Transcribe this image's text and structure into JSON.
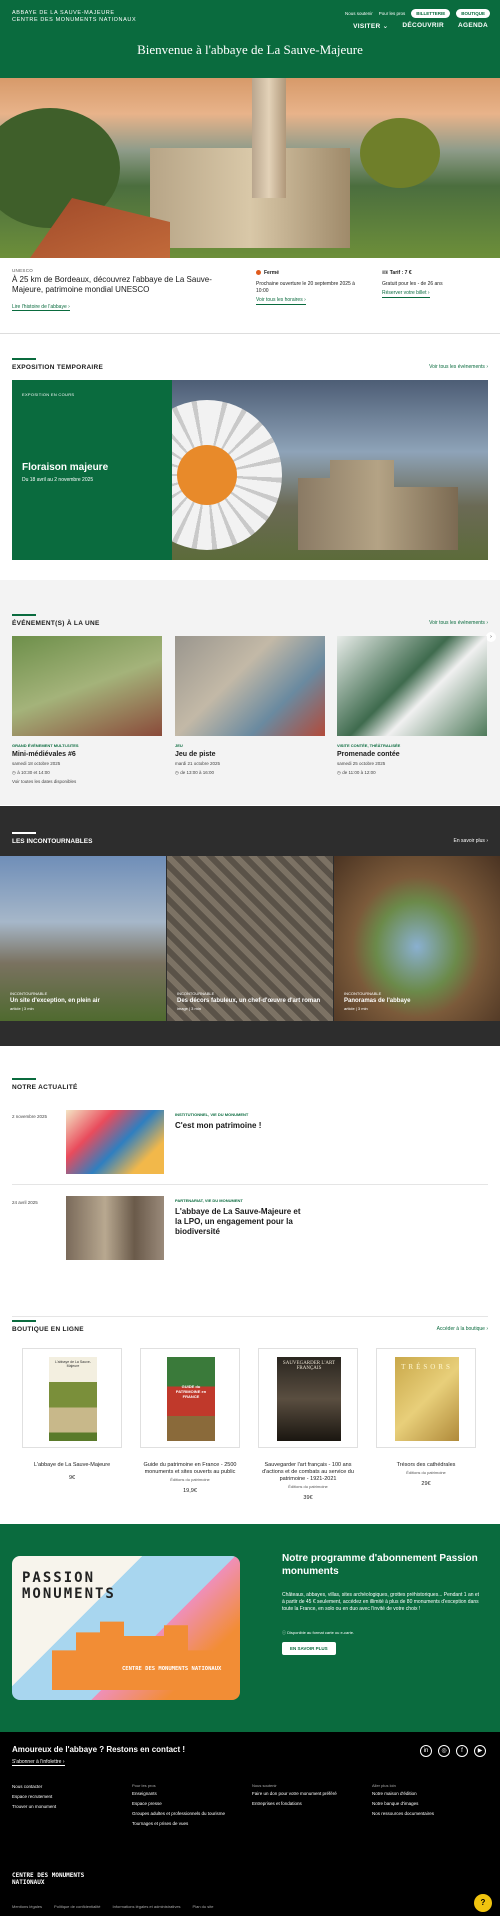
{
  "header": {
    "logo_line1": "ABBAYE DE LA SAUVE-MAJEURE",
    "logo_line2": "CENTRE DES MONUMENTS NATIONAUX",
    "top_links": [
      "Nous soutenir",
      "Pour les pros",
      "BILLETTERIE",
      "BOUTIQUE"
    ],
    "nav": [
      "VISITER",
      "DÉCOUVRIR",
      "AGENDA"
    ],
    "title": "Bienvenue à l'abbaye de La Sauve-Majeure"
  },
  "info": {
    "label": "UNESCO",
    "title": "À 25 km de Bordeaux, découvrez l'abbaye de La Sauve-Majeure, patrimoine mondial UNESCO",
    "link": "Lire l'histoire de l'abbaye",
    "status": "Fermé",
    "opening": "Prochaine ouverture le 20 septembre 2025 à 10:00",
    "hours_link": "Voir tous les horaires",
    "tarif": "Tarif : 7 €",
    "tarif_note": "Gratuit pour les - de 26 ans",
    "ticket_link": "Réserver votre billet"
  },
  "expo": {
    "section_title": "EXPOSITION TEMPORAIRE",
    "see_all": "Voir tous les événements",
    "tag": "EXPOSITION EN COURS",
    "title": "Floraison majeure",
    "dates": "Du 18 avril au 2 novembre 2025"
  },
  "events": {
    "section_title": "ÉVÉNEMENT(S) À LA UNE",
    "see_all": "Voir tous les événements",
    "items": [
      {
        "tag": "GRAND ÉVÉNEMENT MULTI-SITES",
        "title": "Mini-médiévales #6",
        "date": "samedi 18 octobre 2025",
        "time": "à 10:30 et 14:00",
        "extra": "Voir toutes les dates disponibles"
      },
      {
        "tag": "JEU",
        "title": "Jeu de piste",
        "date": "mardi 21 octobre 2025",
        "time": "de 13:00 à 16:00",
        "extra": ""
      },
      {
        "tag": "VISITE CONTÉE, THÉÂTRALISÉE",
        "title": "Promenade contée",
        "date": "samedi 25 octobre 2025",
        "time": "de 11:00 à 12:00",
        "extra": ""
      }
    ]
  },
  "incontournables": {
    "section_title": "LES INCONTOURNABLES",
    "more": "En savoir plus",
    "items": [
      {
        "tag": "INCONTOURNABLE",
        "title": "Un site d'exception, en plein air",
        "meta": "article | 3 min"
      },
      {
        "tag": "INCONTOURNABLE",
        "title": "Des décors fabuleux, un chef-d'œuvre d'art roman",
        "meta": "image | 3 min"
      },
      {
        "tag": "INCONTOURNABLE",
        "title": "Panoramas de l'abbaye",
        "meta": "article | 3 min"
      }
    ]
  },
  "news": {
    "section_title": "NOTRE ACTUALITÉ",
    "items": [
      {
        "date": "2 novembre 2025",
        "tag": "INSTITUTIONNEL, VIE DU MONUMENT",
        "title": "C'est mon patrimoine !"
      },
      {
        "date": "24 avril 2025",
        "tag": "PARTENARIAT, VIE DU MONUMENT",
        "title": "L'abbaye de La Sauve-Majeure et la LPO, un engagement pour la biodiversité"
      }
    ]
  },
  "shop": {
    "section_title": "BOUTIQUE EN LIGNE",
    "link": "Accéder à la boutique",
    "items": [
      {
        "name": "L'abbaye de La Sauve-Majeure",
        "sub": "",
        "price": "9€",
        "cover": "L'abbaye de La Sauve-Majeure"
      },
      {
        "name": "Guide du patrimoine en France - 2500 monuments et sites ouverts au public",
        "sub": "Éditions du patrimoine",
        "price": "19,9€",
        "cover": "GUIDE du PATRIMOINE en FRANCE"
      },
      {
        "name": "Sauvegarder l'art français - 100 ans d'actions et de combats au service du patrimoine - 1921-2021",
        "sub": "Éditions du patrimoine",
        "price": "39€",
        "cover": "SAUVEGARDER L'ART FRANÇAIS"
      },
      {
        "name": "Trésors des cathédrales",
        "sub": "Éditions du patrimoine",
        "price": "29€",
        "cover": "TRÉSORS"
      }
    ]
  },
  "abonnement": {
    "card_word": "PASSION MONUMENTS",
    "card_brand": "CENTRE DES MONUMENTS NATIONAUX",
    "title": "Notre programme d'abonnement Passion monuments",
    "text": "Châteaux, abbayes, villas, sites archéologiques, grottes préhistoriques... Pendant 1 an et à partir de 45 € seulement, accédez en illimité à plus de 80 monuments d'exception dans toute la France, en solo ou en duo avec l'invité de votre choix !",
    "note": "Disponible au format carte ou e-carte.",
    "button": "EN SAVOIR PLUS"
  },
  "footer": {
    "title": "Amoureux de l'abbaye ? Restons en contact !",
    "subscribe": "S'abonner à l'infolettre",
    "columns": [
      {
        "head": "",
        "links": [
          "Nous contacter",
          "Espace recrutement",
          "Trouver un monument"
        ]
      },
      {
        "head": "Pour les pros",
        "links": [
          "Enseignants",
          "Espace presse",
          "Groupes adultes et professionnels du tourisme",
          "Tournages et prises de vues"
        ]
      },
      {
        "head": "Nous soutenir",
        "links": [
          "Faire un don pour votre monument préféré",
          "Entreprises et fondations"
        ]
      },
      {
        "head": "Aller plus loin",
        "links": [
          "Notre maison d'édition",
          "Notre banque d'images",
          "Nos ressources documentaires"
        ]
      }
    ],
    "logo": "CENTRE DES MONUMENTS NATIONAUX",
    "legal": [
      "Mentions légales",
      "Politique de confidentialité",
      "Informations légales et administratives",
      "Plan du site"
    ]
  }
}
